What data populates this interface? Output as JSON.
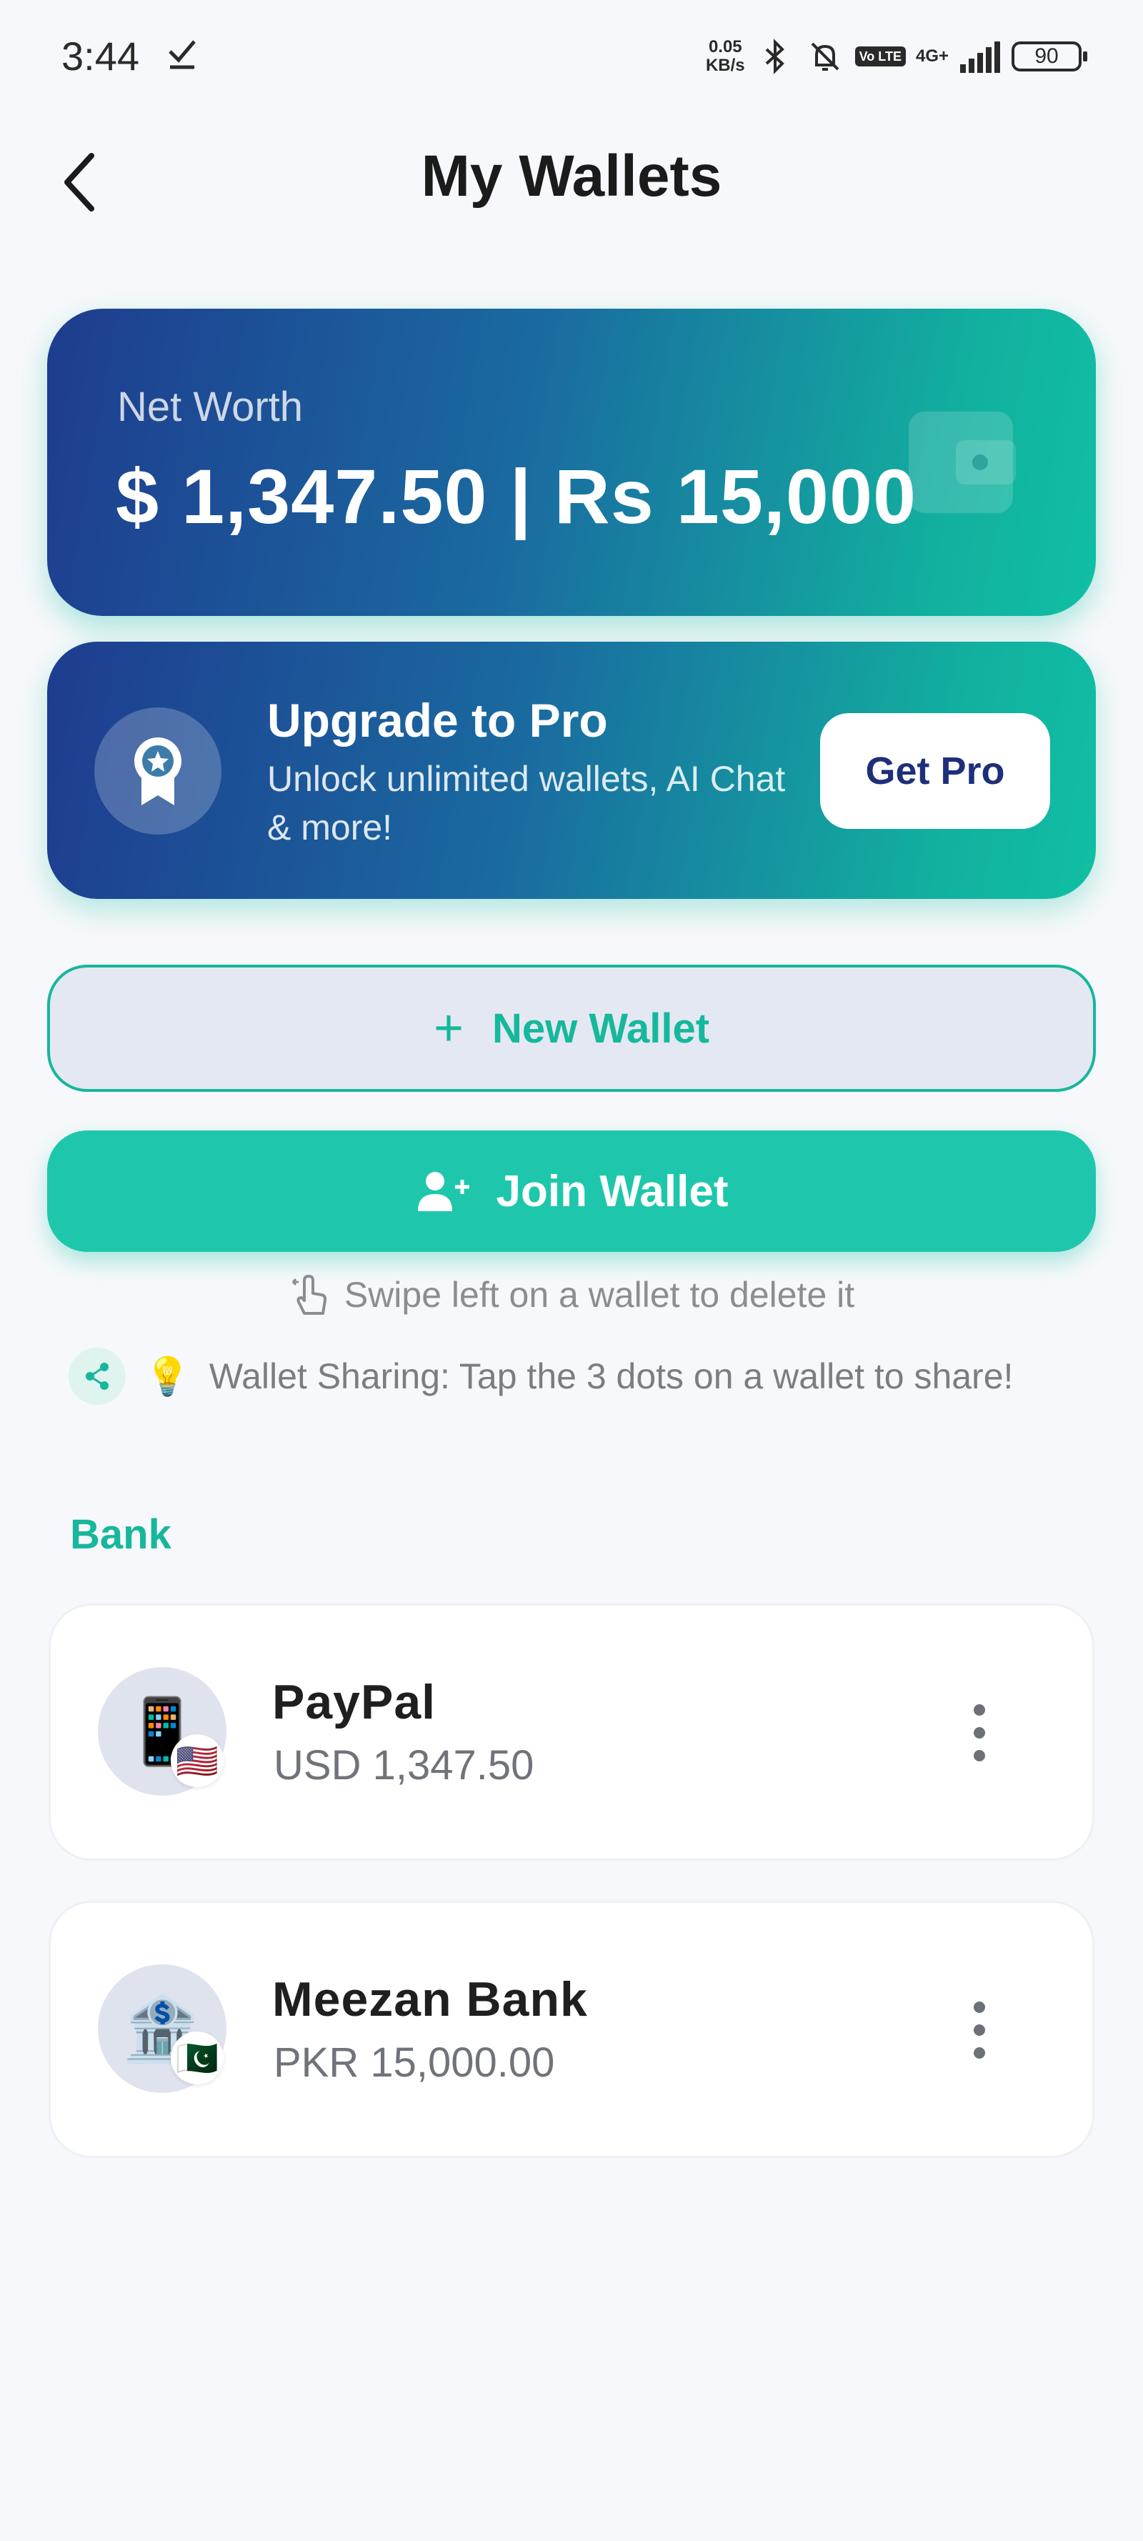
{
  "status_bar": {
    "time": "3:44",
    "speed_top": "0.05",
    "speed_bottom": "KB/s",
    "volte": "Vo LTE",
    "network": "4G+",
    "battery": "90"
  },
  "header": {
    "title": "My Wallets"
  },
  "net_worth": {
    "label": "Net Worth",
    "value": "$ 1,347.50 | Rs 15,000"
  },
  "upgrade": {
    "title": "Upgrade to Pro",
    "subtitle": "Unlock unlimited wallets, AI Chat & more!",
    "button": "Get Pro"
  },
  "actions": {
    "new_wallet": "New Wallet",
    "join_wallet": "Join Wallet"
  },
  "hints": {
    "swipe": "Swipe left on a wallet to delete it",
    "sharing": "Wallet Sharing: Tap the 3 dots on a wallet to share!",
    "bulb": "💡"
  },
  "section": {
    "title": "Bank"
  },
  "wallets": [
    {
      "name": "PayPal",
      "balance": "USD 1,347.50",
      "icon": "📱",
      "flag": "🇺🇸"
    },
    {
      "name": "Meezan Bank",
      "balance": "PKR 15,000.00",
      "icon": "🏦",
      "flag": "🇵🇰"
    }
  ],
  "colors": {
    "accent": "#17b79c",
    "card_gradient_start": "#1e3c8f",
    "card_gradient_end": "#10bfa3",
    "pro_button_text": "#1e2f7a"
  }
}
